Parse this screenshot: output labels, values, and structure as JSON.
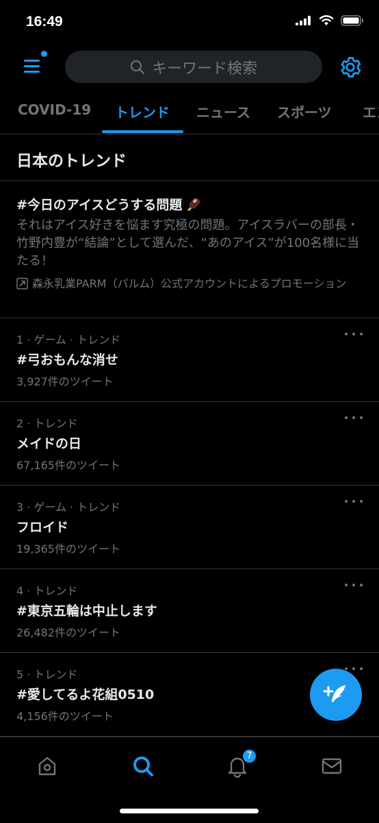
{
  "status_bar": {
    "time": "16:49",
    "signal_icon": "cellular-signal-icon",
    "wifi_icon": "wifi-icon",
    "battery_icon": "battery-icon"
  },
  "header": {
    "menu_icon": "menu-icon",
    "search": {
      "placeholder": "キーワード検索",
      "icon": "search-icon"
    },
    "settings_icon": "gear-icon"
  },
  "tabs": [
    {
      "label": "COVID-19",
      "active": false
    },
    {
      "label": "トレンド",
      "active": true
    },
    {
      "label": "ニュース",
      "active": false
    },
    {
      "label": "スポーツ",
      "active": false
    },
    {
      "label": "エン",
      "active": false
    }
  ],
  "section_title": "日本のトレンド",
  "promo": {
    "title": "#今日のアイスどうする問題",
    "emoji_icon": "ice-cream-bar-icon",
    "description": "それはアイス好きを悩ます究極の問題。アイスラバーの部長・竹野内豊が“結論”として選んだ、“あのアイス”が100名様に当たる！",
    "promoted_icon": "promoted-arrow-icon",
    "promoted_by": "森永乳業PARM（パルム）公式アカウントによるプロモーション"
  },
  "trends": [
    {
      "meta": "1 · ゲーム · トレンド",
      "name": "#弓おもんな消せ",
      "count": "3,927件のツイート"
    },
    {
      "meta": "2 · トレンド",
      "name": "メイドの日",
      "count": "67,165件のツイート"
    },
    {
      "meta": "3 · ゲーム · トレンド",
      "name": "フロイド",
      "count": "19,365件のツイート"
    },
    {
      "meta": "4 · トレンド",
      "name": "#東京五輪は中止します",
      "count": "26,482件のツイート"
    },
    {
      "meta": "5 · トレンド",
      "name": "#愛してるよ花組0510",
      "count": "4,156件のツイート"
    }
  ],
  "fab_icon": "compose-tweet-icon",
  "bottom_nav": {
    "items": [
      {
        "icon": "home-icon",
        "active": false
      },
      {
        "icon": "search-icon",
        "active": true
      },
      {
        "icon": "notifications-bell-icon",
        "active": false,
        "badge": "7"
      },
      {
        "icon": "messages-envelope-icon",
        "active": false
      }
    ]
  },
  "colors": {
    "accent": "#1d9bf0",
    "background": "#000000",
    "secondary_text": "#71767b",
    "divider": "#2f3336"
  }
}
